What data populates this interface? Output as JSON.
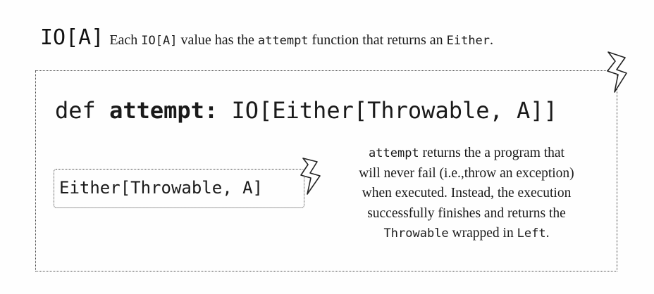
{
  "header": {
    "type_label": "IO[A]",
    "description": {
      "pre": "Each ",
      "code1": "IO[A]",
      "mid": " value has the ",
      "code2": "attempt",
      "post_mid": " function that returns an ",
      "code3": "Either",
      "end": "."
    }
  },
  "signature": {
    "keyword": "def",
    "name": "attempt:",
    "return_type": "IO[Either[Throwable, A]]"
  },
  "inner_type": "Either[Throwable, A]",
  "explanation": {
    "code_start": "attempt",
    "line1_rest": " returns the a program that",
    "line2": "will never fail (i.e.,throw an exception)",
    "line3": "when executed. Instead, the execution",
    "line4": "successfully finishes and returns the",
    "code_throwable": "Throwable",
    "line5_mid": " wrapped in ",
    "code_left": "Left",
    "line5_end": "."
  }
}
